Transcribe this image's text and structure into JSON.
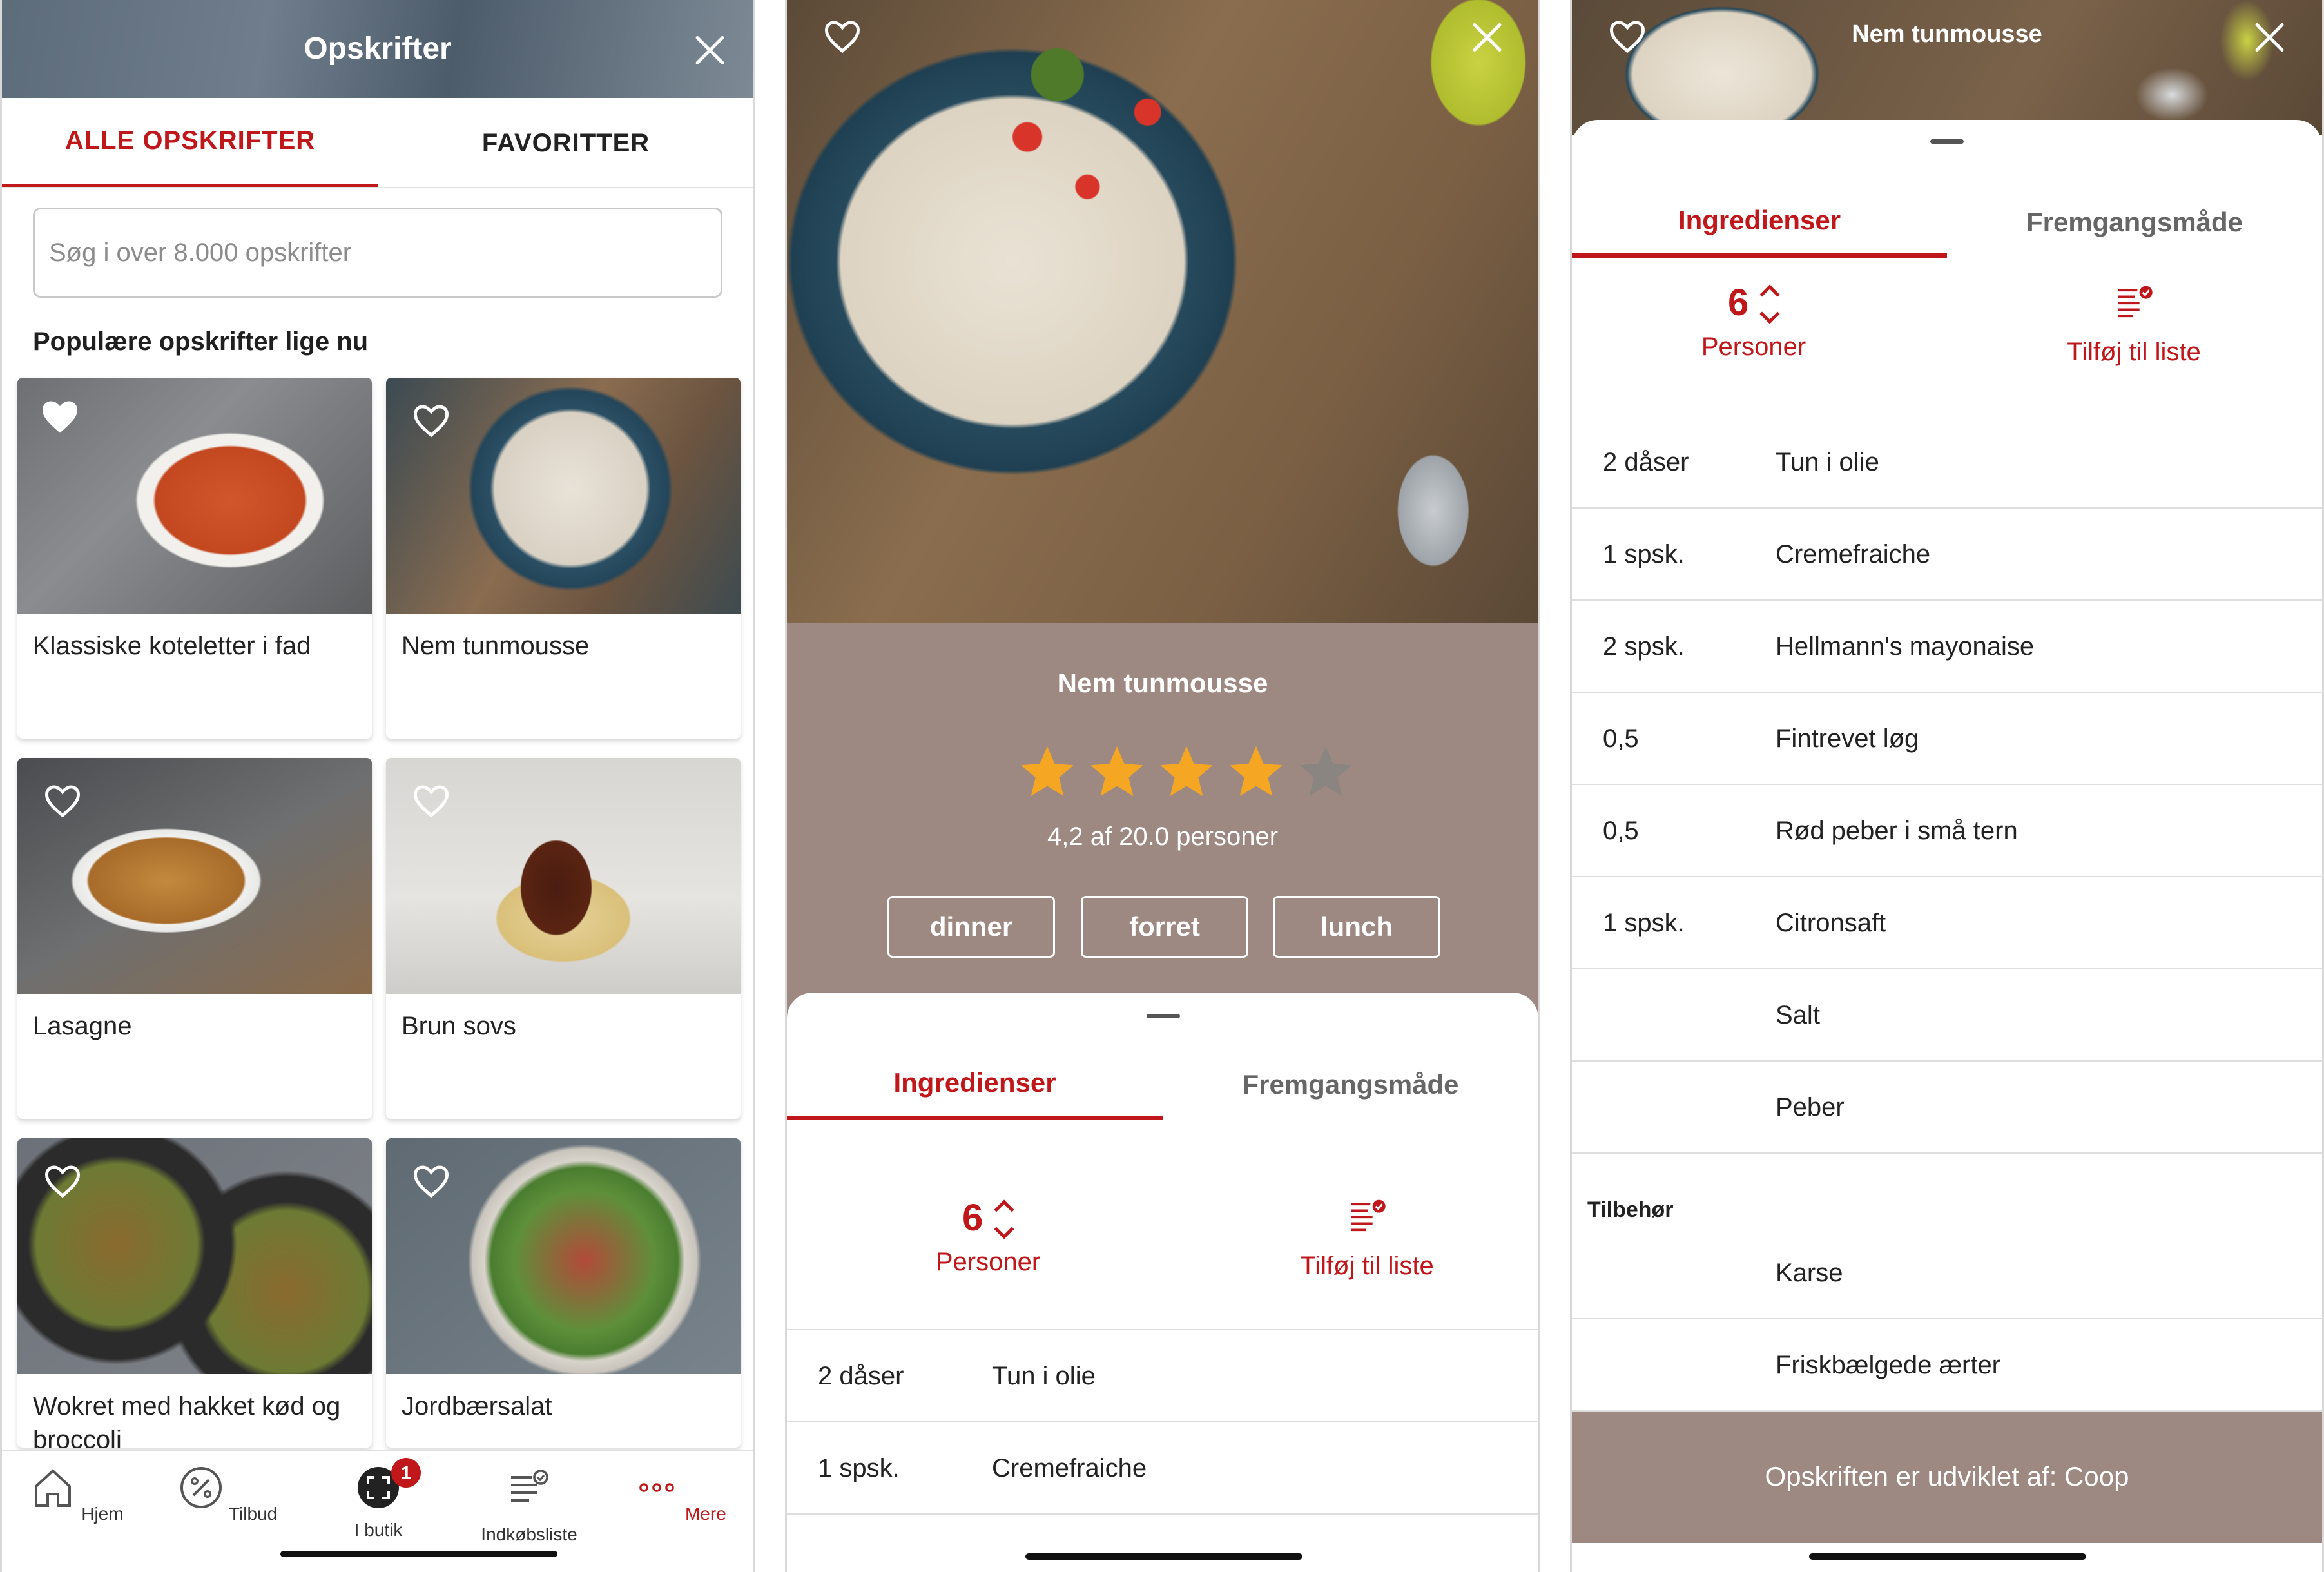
{
  "screen1": {
    "header_title": "Opskrifter",
    "tabs": [
      {
        "label": "ALLE OPSKRIFTER",
        "active": true
      },
      {
        "label": "FAVORITTER",
        "active": false
      }
    ],
    "search_placeholder": "Søg i over 8.000 opskrifter",
    "section_title": "Populære opskrifter lige nu",
    "recipes": [
      {
        "name": "Klassiske koteletter i fad",
        "favorite": true
      },
      {
        "name": "Nem tunmousse",
        "favorite": false
      },
      {
        "name": "Lasagne",
        "favorite": false
      },
      {
        "name": "Brun sovs",
        "favorite": false
      },
      {
        "name": "Wokret med hakket kød og broccoli",
        "favorite": false
      },
      {
        "name": "Jordbærsalat",
        "favorite": false
      }
    ],
    "nav": [
      {
        "label": "Hjem",
        "icon": "home-icon"
      },
      {
        "label": "Tilbud",
        "icon": "percent-icon"
      },
      {
        "label": "I butik",
        "icon": "scan-icon",
        "badge": "1"
      },
      {
        "label": "Indkøbsliste",
        "icon": "list-icon"
      },
      {
        "label": "Mere",
        "icon": "more-icon",
        "active": true
      }
    ]
  },
  "screen2": {
    "recipe_title": "Nem tunmousse",
    "rating_stars": 4,
    "rating_text": "4,2 af 20.0 personer",
    "tags": [
      "dinner",
      "forret",
      "lunch"
    ],
    "tabs": [
      {
        "label": "Ingredienser",
        "active": true
      },
      {
        "label": "Fremgangsmåde",
        "active": false
      }
    ],
    "servings": "6",
    "servings_label": "Personer",
    "add_to_list": "Tilføj til liste",
    "ingredients": [
      {
        "amount": "2 dåser",
        "name": "Tun i olie"
      },
      {
        "amount": "1 spsk.",
        "name": "Cremefraiche"
      }
    ]
  },
  "screen3": {
    "header_title": "Nem tunmousse",
    "tabs": [
      {
        "label": "Ingredienser",
        "active": true
      },
      {
        "label": "Fremgangsmåde",
        "active": false
      }
    ],
    "servings": "6",
    "servings_label": "Personer",
    "add_to_list": "Tilføj til liste",
    "ingredients": [
      {
        "amount": "2 dåser",
        "name": "Tun i olie"
      },
      {
        "amount": "1 spsk.",
        "name": "Cremefraiche"
      },
      {
        "amount": "2 spsk.",
        "name": "Hellmann's mayonaise"
      },
      {
        "amount": "0,5",
        "name": "Fintrevet løg"
      },
      {
        "amount": "0,5",
        "name": "Rød peber i små tern"
      },
      {
        "amount": "1 spsk.",
        "name": "Citronsaft"
      },
      {
        "amount": "",
        "name": "Salt"
      },
      {
        "amount": "",
        "name": "Peber"
      }
    ],
    "accessories_title": "Tilbehør",
    "accessories": [
      {
        "amount": "",
        "name": "Karse"
      },
      {
        "amount": "",
        "name": "Friskbælgede ærter"
      }
    ],
    "footer": "Opskriften er udviklet af: Coop"
  },
  "colors": {
    "accent": "#c0171b",
    "brown": "#9e8982",
    "star": "#f5a623",
    "star_empty": "#8a8580"
  }
}
